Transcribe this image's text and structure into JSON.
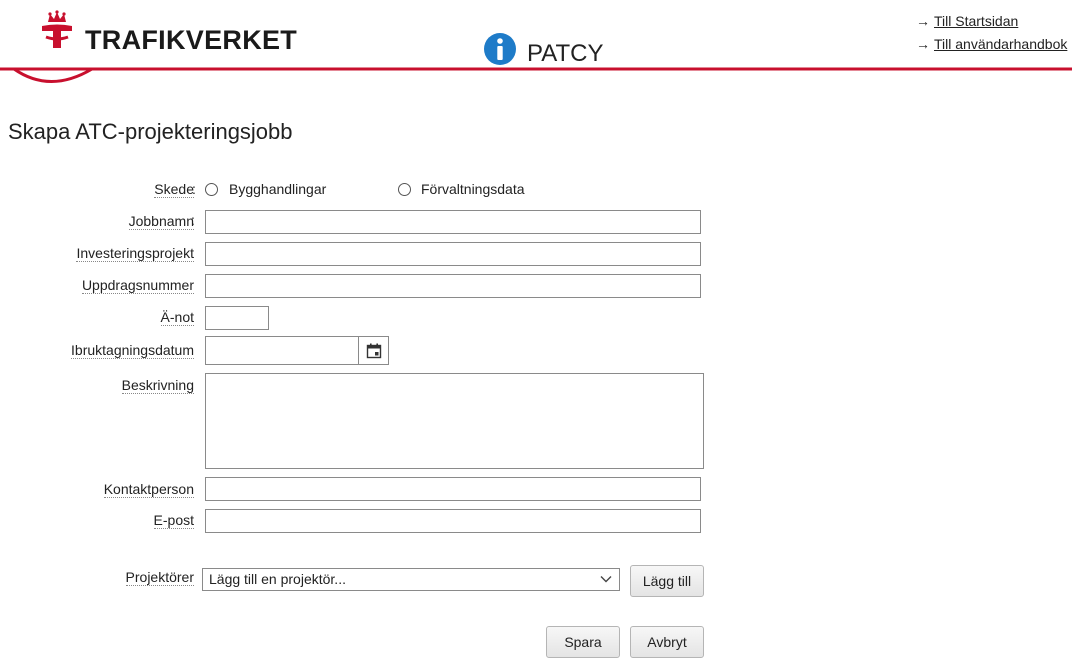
{
  "header": {
    "logo_text": "TRAFIKVERKET",
    "app_name": "PATCY",
    "links": [
      {
        "arrow": "→",
        "label": "Till Startsidan"
      },
      {
        "arrow": "→",
        "label": "Till användarhandbok"
      }
    ],
    "accent_color": "#c8102e",
    "info_color": "#1e7bc8"
  },
  "page": {
    "title": "Skapa ATC-projekteringsjobb"
  },
  "form": {
    "skede": {
      "label": "Skede",
      "options": [
        "Bygghandlingar",
        "Förvaltningsdata"
      ],
      "selected": null
    },
    "jobbnamn": {
      "label": "Jobbnamn",
      "value": ""
    },
    "investeringsprojekt": {
      "label": "Investeringsprojekt",
      "value": ""
    },
    "uppdragsnummer": {
      "label": "Uppdragsnummer",
      "value": ""
    },
    "anot": {
      "label": "Ä-not",
      "value": ""
    },
    "ibruktagningsdatum": {
      "label": "Ibruktagningsdatum",
      "value": "",
      "icon": "calendar-icon"
    },
    "beskrivning": {
      "label": "Beskrivning",
      "value": ""
    },
    "kontaktperson": {
      "label": "Kontaktperson",
      "value": ""
    },
    "epost": {
      "label": "E-post",
      "value": ""
    },
    "projektorer": {
      "label": "Projektörer",
      "select_value": "Lägg till en projektör...",
      "add_button": "Lägg till"
    },
    "separator": ":",
    "save_button": "Spara",
    "cancel_button": "Avbryt"
  }
}
